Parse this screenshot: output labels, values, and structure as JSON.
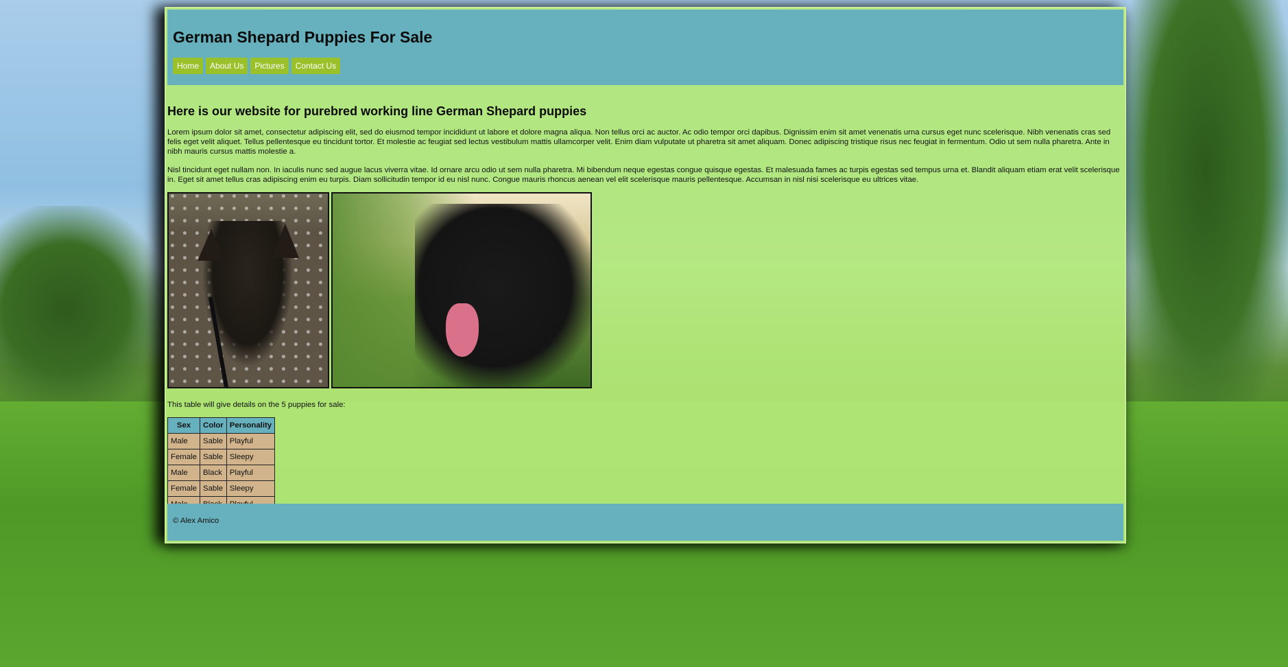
{
  "site": {
    "title": "German Shepard Puppies For Sale"
  },
  "nav": {
    "items": [
      {
        "label": "Home"
      },
      {
        "label": "About Us"
      },
      {
        "label": "Pictures"
      },
      {
        "label": "Contact Us"
      }
    ]
  },
  "main": {
    "heading": "Here is our website for purebred working line German Shepard puppies",
    "paragraph1": "Lorem ipsum dolor sit amet, consectetur adipiscing elit, sed do eiusmod tempor incididunt ut labore et dolore magna aliqua. Non tellus orci ac auctor. Ac odio tempor orci dapibus. Dignissim enim sit amet venenatis urna cursus eget nunc scelerisque. Nibh venenatis cras sed felis eget velit aliquet. Tellus pellentesque eu tincidunt tortor. Et molestie ac feugiat sed lectus vestibulum mattis ullamcorper velit. Enim diam vulputate ut pharetra sit amet aliquam. Donec adipiscing tristique risus nec feugiat in fermentum. Odio ut sem nulla pharetra. Ante in nibh mauris cursus mattis molestie a.",
    "paragraph2": "Nisl tincidunt eget nullam non. In iaculis nunc sed augue lacus viverra vitae. Id ornare arcu odio ut sem nulla pharetra. Mi bibendum neque egestas congue quisque egestas. Et malesuada fames ac turpis egestas sed tempus urna et. Blandit aliquam etiam erat velit scelerisque in. Eget sit amet tellus cras adipiscing enim eu turpis. Diam sollicitudin tempor id eu nisl nunc. Congue mauris rhoncus aenean vel elit scelerisque mauris pellentesque. Accumsan in nisl nisi scelerisque eu ultrices vitae.",
    "table_intro": "This table will give details on the 5 puppies for sale:"
  },
  "table": {
    "headers": [
      "Sex",
      "Color",
      "Personality"
    ],
    "rows": [
      [
        "Male",
        "Sable",
        "Playful"
      ],
      [
        "Female",
        "Sable",
        "Sleepy"
      ],
      [
        "Male",
        "Black",
        "Playful"
      ],
      [
        "Female",
        "Sable",
        "Sleepy"
      ],
      [
        "Male",
        "Black",
        "Playful"
      ]
    ]
  },
  "footer": {
    "text": "© Alex Amico"
  },
  "colors": {
    "header_bg": "#66b1bd",
    "content_bg": "#b4e878",
    "nav_button_bg": "#9bc12a",
    "table_cell_bg": "#d1b48c"
  }
}
